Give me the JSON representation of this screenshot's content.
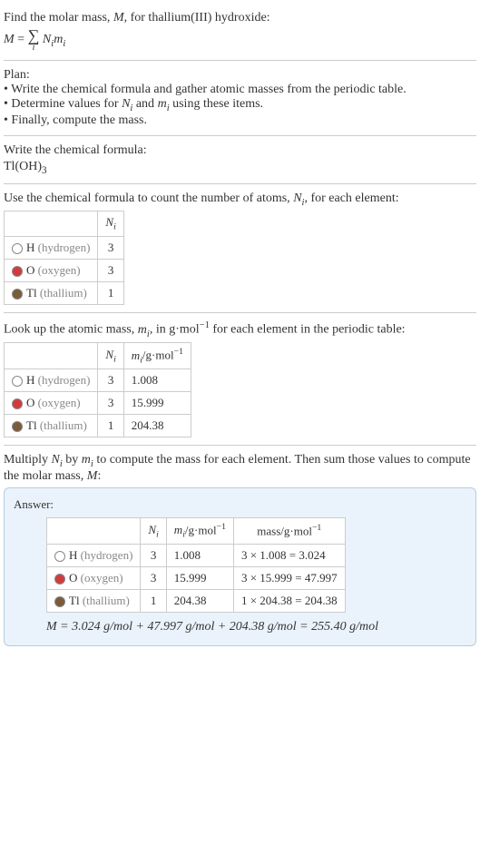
{
  "intro": {
    "line1_a": "Find the molar mass, ",
    "line1_b": ", for thallium(III) hydroxide:",
    "M": "M",
    "eq": " = ",
    "Nimi": "N",
    "Nimi2": "m"
  },
  "plan": {
    "heading": "Plan:",
    "b1": "• Write the chemical formula and gather atomic masses from the periodic table.",
    "b2_a": "• Determine values for ",
    "b2_b": " and ",
    "b2_c": " using these items.",
    "b3": "• Finally, compute the mass."
  },
  "write": {
    "heading": "Write the chemical formula:",
    "formula_a": "Tl(OH)",
    "formula_sub": "3"
  },
  "count": {
    "heading_a": "Use the chemical formula to count the number of atoms, ",
    "heading_b": ", for each element:",
    "header_Ni": "N",
    "rows": [
      {
        "color": "#ffffff",
        "sym": "H",
        "name": "(hydrogen)",
        "n": "3"
      },
      {
        "color": "#d23b3b",
        "sym": "O",
        "name": "(oxygen)",
        "n": "3"
      },
      {
        "color": "#7a5b3a",
        "sym": "Tl",
        "name": "(thallium)",
        "n": "1"
      }
    ]
  },
  "lookup": {
    "heading_a": "Look up the atomic mass, ",
    "heading_b": ", in g·mol",
    "heading_c": " for each element in the periodic table:",
    "header_mi": "m",
    "unit_a": "/g·mol",
    "rows": [
      {
        "color": "#ffffff",
        "sym": "H",
        "name": "(hydrogen)",
        "n": "3",
        "m": "1.008"
      },
      {
        "color": "#d23b3b",
        "sym": "O",
        "name": "(oxygen)",
        "n": "3",
        "m": "15.999"
      },
      {
        "color": "#7a5b3a",
        "sym": "Tl",
        "name": "(thallium)",
        "n": "1",
        "m": "204.38"
      }
    ]
  },
  "multiply": {
    "heading_a": "Multiply ",
    "heading_b": " by ",
    "heading_c": " to compute the mass for each element. Then sum those values to compute the molar mass, ",
    "heading_d": ":"
  },
  "answer": {
    "label": "Answer:",
    "mass_header": "mass/g·mol",
    "rows": [
      {
        "color": "#ffffff",
        "sym": "H",
        "name": "(hydrogen)",
        "n": "3",
        "m": "1.008",
        "calc": "3 × 1.008 = 3.024"
      },
      {
        "color": "#d23b3b",
        "sym": "O",
        "name": "(oxygen)",
        "n": "3",
        "m": "15.999",
        "calc": "3 × 15.999 = 47.997"
      },
      {
        "color": "#7a5b3a",
        "sym": "Tl",
        "name": "(thallium)",
        "n": "1",
        "m": "204.38",
        "calc": "1 × 204.38 = 204.38"
      }
    ],
    "sum": "M = 3.024 g/mol + 47.997 g/mol + 204.38 g/mol = 255.40 g/mol"
  }
}
